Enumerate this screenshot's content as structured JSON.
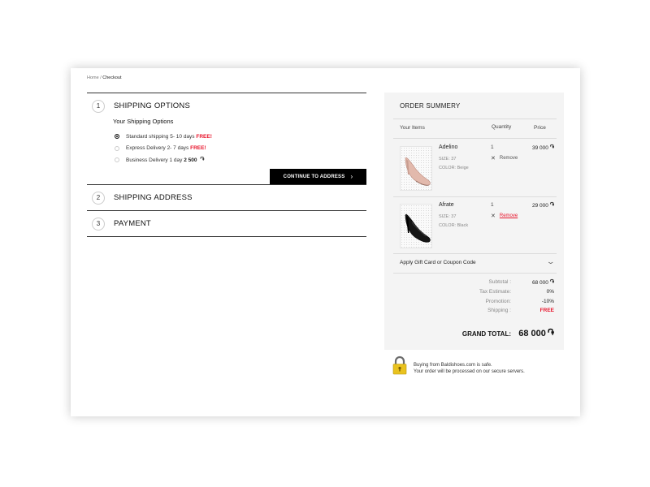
{
  "breadcrumb": {
    "home": "Home",
    "separator": "/",
    "current": "Checkout"
  },
  "steps": [
    {
      "number": "1",
      "title": "SHIPPING OPTIONS"
    },
    {
      "number": "2",
      "title": "SHIPPING ADDRESS"
    },
    {
      "number": "3",
      "title": "PAYMENT"
    }
  ],
  "shipping": {
    "heading": "Your Shipping Options",
    "options": [
      {
        "label": "Standard shipping 5- 10 days",
        "price": "FREE!",
        "selected": true
      },
      {
        "label": "Express Delivery 2- 7 days",
        "price": "FREE!",
        "selected": false
      },
      {
        "label": "Business Delivery 1 day",
        "price": "2 500",
        "currency": "֏",
        "selected": false
      }
    ],
    "continue_label": "CONTINUE TO ADDRESS",
    "continue_icon": "›"
  },
  "summary": {
    "title": "ORDER SUMMERY",
    "col_items": "Your Items",
    "col_quantity": "Quantity",
    "col_price": "Price",
    "items": [
      {
        "name": "Adelino",
        "size": "SIZE: 37",
        "color": "COLOR: Beige",
        "quantity": "1",
        "remove_label": "Remove",
        "price": "39 000",
        "currency": "֏",
        "shoe_color": "#e2b9ac",
        "image_icon": "heel-shoe-icon"
      },
      {
        "name": "Afrate",
        "size": "SIZE: 37",
        "color": "COLOR: Black",
        "quantity": "1",
        "remove_label": "Remove",
        "price": "29 000",
        "currency": "֏",
        "shoe_color": "#151515",
        "image_icon": "heel-shoe-icon"
      }
    ],
    "coupon_label": "Apply Gift Card or Coupon Code",
    "totals": [
      {
        "label": "Subtotal :",
        "value": "68 000",
        "currency": "֏"
      },
      {
        "label": "Tax Estimate:",
        "value": "0%"
      },
      {
        "label": "Promotion:",
        "value": "-10%"
      },
      {
        "label": "Shipping :",
        "value": "FREE"
      }
    ],
    "grand_total_label": "GRAND TOTAL:",
    "grand_total_value": "68 000",
    "grand_total_currency": "֏"
  },
  "secure": {
    "line1": "Buying from Baldishoes.com is safe.",
    "line2": "Your order will be processed on our secure servers.",
    "icon": "padlock-icon"
  },
  "colors": {
    "accent_red": "#e8132a",
    "button_black": "#000000",
    "lock_yellow": "#e9c21f"
  }
}
